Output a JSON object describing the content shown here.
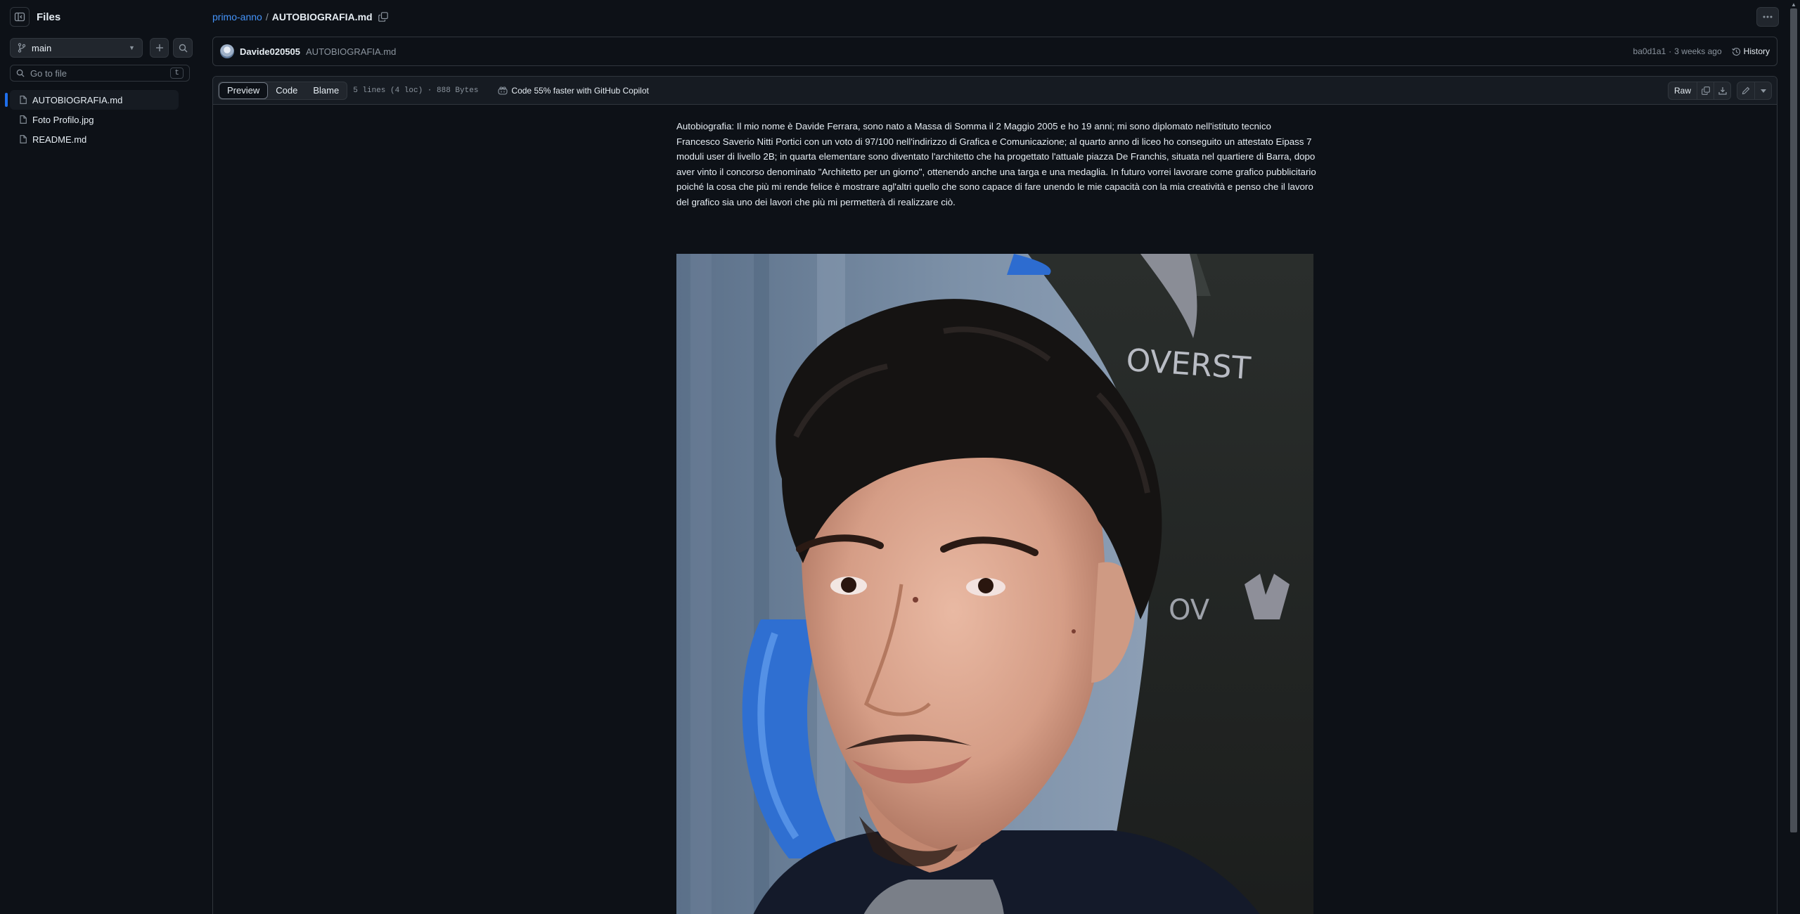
{
  "sidebar": {
    "title": "Files",
    "branch": "main",
    "goto_placeholder": "Go to file",
    "goto_shortcut": "t",
    "files": [
      {
        "name": "AUTOBIOGRAFIA.md",
        "active": true
      },
      {
        "name": "Foto Profilo.jpg",
        "active": false
      },
      {
        "name": "README.md",
        "active": false
      }
    ]
  },
  "breadcrumb": {
    "repo": "primo-anno",
    "separator": "/",
    "file": "AUTOBIOGRAFIA.md"
  },
  "commit": {
    "author": "Davide020505",
    "message": "AUTOBIOGRAFIA.md",
    "hash": "ba0d1a1",
    "dot": "·",
    "time": "3 weeks ago",
    "history": "History"
  },
  "viewer": {
    "tabs": {
      "preview": "Preview",
      "code": "Code",
      "blame": "Blame"
    },
    "fileinfo": "5 lines (4 loc) · 888 Bytes",
    "copilot": "Code 55% faster with GitHub Copilot",
    "raw": "Raw"
  },
  "content": {
    "paragraph": "Autobiografia: Il mio nome è Davide Ferrara, sono nato a Massa di Somma il 2 Maggio 2005 e ho 19 anni; mi sono diplomato nell'istituto tecnico Francesco Saverio Nitti Portici con un voto di 97/100 nell'indirizzo di Grafica e Comunicazione; al quarto anno di liceo ho conseguito un attestato Eipass 7 moduli user di livello 2B; in quarta elementare sono diventato l'architetto che ha progettato l'attuale piazza De Franchis, situata nel quartiere di Barra, dopo aver vinto il concorso denominato \"Architetto per un giorno\", ottenendo anche una targa e una medaglia. In futuro vorrei lavorare come grafico pubblicitario poiché la cosa che più mi rende felice è mostrare agl'altri quello che sono capace di fare unendo le mie capacità con la mia creatività e penso che il lavoro del grafico sia uno dei lavori che più mi permetterà di realizzare ciò.",
    "photo_chair_text": "OVERST",
    "photo_chair_text2": "OV"
  },
  "icons": {
    "sidebar_toggle": "sidebar-collapse-icon",
    "branch": "git-branch-icon",
    "plus": "plus-icon",
    "search": "search-icon",
    "file": "file-icon",
    "copy": "copy-icon",
    "kebab": "kebab-horizontal-icon",
    "history": "history-icon",
    "copilot": "copilot-icon",
    "download": "download-icon",
    "pencil": "pencil-icon",
    "triangle_down": "triangle-down-icon"
  },
  "colors": {
    "background": "#0d1117",
    "link": "#4493f8",
    "border": "#30363d",
    "active_indicator": "#1f6feb"
  }
}
